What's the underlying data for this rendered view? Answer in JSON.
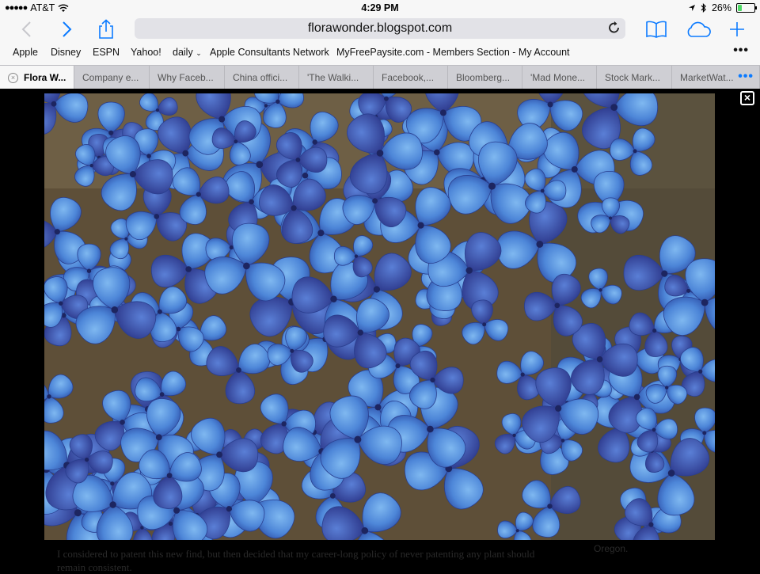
{
  "status_bar": {
    "carrier": "AT&T",
    "time": "4:29 PM",
    "battery": "26%",
    "battery_level": 0.26
  },
  "toolbar": {
    "url": "florawonder.blogspot.com"
  },
  "bookmarks": [
    "Apple",
    "Disney",
    "ESPN",
    "Yahoo!",
    "daily",
    "Apple Consultants Network",
    "MyFreePaysite.com - Members Section - My Account"
  ],
  "tabs": [
    "Flora W...",
    "Company e...",
    "Why Faceb...",
    "China offici...",
    "'The Walki...",
    "Facebook,...",
    "Bloomberg...",
    "'Mad Mone...",
    "Stock Mark...",
    "MarketWat..."
  ],
  "page": {
    "caption": "I considered to patent this new find, but then decided that my career-long policy of never patenting any plant should remain consistent.",
    "sidebar_text": "Oregon."
  },
  "colors": {
    "accent": "#0a7aff"
  }
}
